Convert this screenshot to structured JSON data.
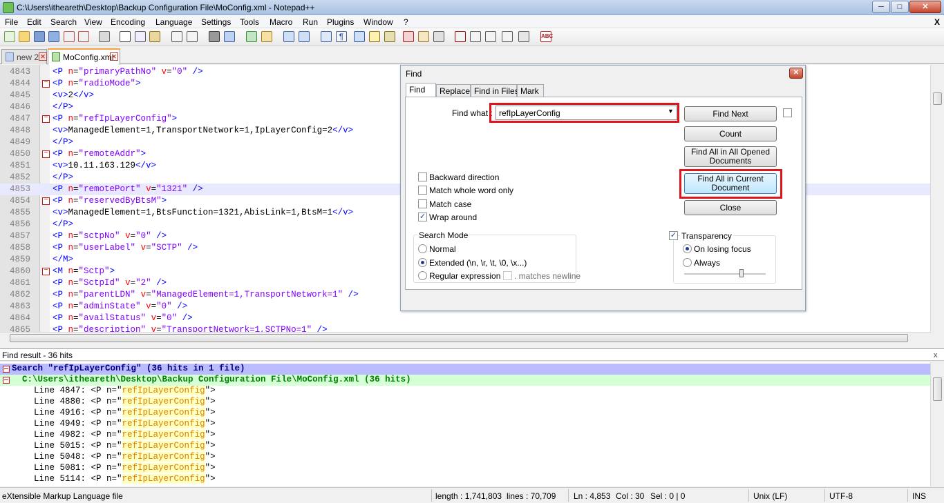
{
  "window": {
    "title": "C:\\Users\\itheareth\\Desktop\\Backup Configuration File\\MoConfig.xml - Notepad++",
    "minimize": "─",
    "maximize": "□",
    "close": "✕"
  },
  "menu": [
    "File",
    "Edit",
    "Search",
    "View",
    "Encoding",
    "Language",
    "Settings",
    "Tools",
    "Macro",
    "Run",
    "Plugins",
    "Window",
    "?"
  ],
  "menu_close": "X",
  "tabs": [
    {
      "label": "new 2",
      "active": false
    },
    {
      "label": "MoConfig.xml",
      "active": true
    }
  ],
  "editor": {
    "lines": [
      {
        "num": "4843",
        "fold": "",
        "code": [
          [
            "tg",
            "<P "
          ],
          [
            "at",
            "n"
          ],
          [
            "tx",
            "="
          ],
          [
            "av",
            "\"primaryPathNo\""
          ],
          [
            "tx",
            " "
          ],
          [
            "at",
            "v"
          ],
          [
            "tx",
            "="
          ],
          [
            "av",
            "\"0\""
          ],
          [
            "tg",
            " />"
          ]
        ]
      },
      {
        "num": "4844",
        "fold": "−",
        "code": [
          [
            "tg",
            "<P "
          ],
          [
            "at",
            "n"
          ],
          [
            "tx",
            "="
          ],
          [
            "av",
            "\"radioMode\""
          ],
          [
            "tg",
            ">"
          ]
        ]
      },
      {
        "num": "4845",
        "fold": "",
        "code": [
          [
            "tg",
            "<v>"
          ],
          [
            "tx",
            "2"
          ],
          [
            "tg",
            "</v>"
          ]
        ]
      },
      {
        "num": "4846",
        "fold": "",
        "code": [
          [
            "tg",
            "</P>"
          ]
        ]
      },
      {
        "num": "4847",
        "fold": "−",
        "code": [
          [
            "tg",
            "<P "
          ],
          [
            "at",
            "n"
          ],
          [
            "tx",
            "="
          ],
          [
            "av",
            "\"refIpLayerConfig\""
          ],
          [
            "tg",
            ">"
          ]
        ]
      },
      {
        "num": "4848",
        "fold": "",
        "code": [
          [
            "tg",
            "<v>"
          ],
          [
            "tx",
            "ManagedElement=1,TransportNetwork=1,IpLayerConfig=2"
          ],
          [
            "tg",
            "</v>"
          ]
        ]
      },
      {
        "num": "4849",
        "fold": "",
        "code": [
          [
            "tg",
            "</P>"
          ]
        ]
      },
      {
        "num": "4850",
        "fold": "−",
        "code": [
          [
            "tg",
            "<P "
          ],
          [
            "at",
            "n"
          ],
          [
            "tx",
            "="
          ],
          [
            "av",
            "\"remoteAddr\""
          ],
          [
            "tg",
            ">"
          ]
        ]
      },
      {
        "num": "4851",
        "fold": "",
        "code": [
          [
            "tg",
            "<v>"
          ],
          [
            "tx",
            "10.11.163.129"
          ],
          [
            "tg",
            "</v>"
          ]
        ]
      },
      {
        "num": "4852",
        "fold": "",
        "code": [
          [
            "tg",
            "</P>"
          ]
        ]
      },
      {
        "num": "4853",
        "fold": "",
        "current": true,
        "code": [
          [
            "tg",
            "<P "
          ],
          [
            "at",
            "n"
          ],
          [
            "tx",
            "="
          ],
          [
            "av",
            "\"remotePort\""
          ],
          [
            "tx",
            " "
          ],
          [
            "at",
            "v"
          ],
          [
            "tx",
            "="
          ],
          [
            "av",
            "\"1321\""
          ],
          [
            "tg",
            " />"
          ]
        ]
      },
      {
        "num": "4854",
        "fold": "−",
        "code": [
          [
            "tg",
            "<P "
          ],
          [
            "at",
            "n"
          ],
          [
            "tx",
            "="
          ],
          [
            "av",
            "\"reservedByBtsM\""
          ],
          [
            "tg",
            ">"
          ]
        ]
      },
      {
        "num": "4855",
        "fold": "",
        "code": [
          [
            "tg",
            "<v>"
          ],
          [
            "tx",
            "ManagedElement=1,BtsFunction=1321,AbisLink=1,BtsM=1"
          ],
          [
            "tg",
            "</v>"
          ]
        ]
      },
      {
        "num": "4856",
        "fold": "",
        "code": [
          [
            "tg",
            "</P>"
          ]
        ]
      },
      {
        "num": "4857",
        "fold": "",
        "code": [
          [
            "tg",
            "<P "
          ],
          [
            "at",
            "n"
          ],
          [
            "tx",
            "="
          ],
          [
            "av",
            "\"sctpNo\""
          ],
          [
            "tx",
            " "
          ],
          [
            "at",
            "v"
          ],
          [
            "tx",
            "="
          ],
          [
            "av",
            "\"0\""
          ],
          [
            "tg",
            " />"
          ]
        ]
      },
      {
        "num": "4858",
        "fold": "",
        "code": [
          [
            "tg",
            "<P "
          ],
          [
            "at",
            "n"
          ],
          [
            "tx",
            "="
          ],
          [
            "av",
            "\"userLabel\""
          ],
          [
            "tx",
            " "
          ],
          [
            "at",
            "v"
          ],
          [
            "tx",
            "="
          ],
          [
            "av",
            "\"SCTP\""
          ],
          [
            "tg",
            " />"
          ]
        ]
      },
      {
        "num": "4859",
        "fold": "",
        "code": [
          [
            "tg",
            "</M>"
          ]
        ]
      },
      {
        "num": "4860",
        "fold": "−",
        "code": [
          [
            "tg",
            "<M "
          ],
          [
            "at",
            "n"
          ],
          [
            "tx",
            "="
          ],
          [
            "av",
            "\"Sctp\""
          ],
          [
            "tg",
            ">"
          ]
        ]
      },
      {
        "num": "4861",
        "fold": "",
        "code": [
          [
            "tg",
            "<P "
          ],
          [
            "at",
            "n"
          ],
          [
            "tx",
            "="
          ],
          [
            "av",
            "\"SctpId\""
          ],
          [
            "tx",
            " "
          ],
          [
            "at",
            "v"
          ],
          [
            "tx",
            "="
          ],
          [
            "av",
            "\"2\""
          ],
          [
            "tg",
            " />"
          ]
        ]
      },
      {
        "num": "4862",
        "fold": "",
        "code": [
          [
            "tg",
            "<P "
          ],
          [
            "at",
            "n"
          ],
          [
            "tx",
            "="
          ],
          [
            "av",
            "\"parentLDN\""
          ],
          [
            "tx",
            " "
          ],
          [
            "at",
            "v"
          ],
          [
            "tx",
            "="
          ],
          [
            "av",
            "\"ManagedElement=1,TransportNetwork=1\""
          ],
          [
            "tg",
            " />"
          ]
        ]
      },
      {
        "num": "4863",
        "fold": "",
        "code": [
          [
            "tg",
            "<P "
          ],
          [
            "at",
            "n"
          ],
          [
            "tx",
            "="
          ],
          [
            "av",
            "\"adminState\""
          ],
          [
            "tx",
            " "
          ],
          [
            "at",
            "v"
          ],
          [
            "tx",
            "="
          ],
          [
            "av",
            "\"0\""
          ],
          [
            "tg",
            " />"
          ]
        ]
      },
      {
        "num": "4864",
        "fold": "",
        "code": [
          [
            "tg",
            "<P "
          ],
          [
            "at",
            "n"
          ],
          [
            "tx",
            "="
          ],
          [
            "av",
            "\"availStatus\""
          ],
          [
            "tx",
            " "
          ],
          [
            "at",
            "v"
          ],
          [
            "tx",
            "="
          ],
          [
            "av",
            "\"0\""
          ],
          [
            "tg",
            " />"
          ]
        ]
      },
      {
        "num": "4865",
        "fold": "",
        "code": [
          [
            "tg",
            "<P "
          ],
          [
            "at",
            "n"
          ],
          [
            "tx",
            "="
          ],
          [
            "av",
            "\"description\""
          ],
          [
            "tx",
            " "
          ],
          [
            "at",
            "v"
          ],
          [
            "tx",
            "="
          ],
          [
            "av",
            "\"TransportNetwork=1,SCTPNo=1\""
          ],
          [
            "tg",
            " />"
          ]
        ]
      }
    ]
  },
  "find_dialog": {
    "title": "Find",
    "close": "✕",
    "tabs": [
      "Find",
      "Replace",
      "Find in Files",
      "Mark"
    ],
    "find_what_label": "Find what :",
    "find_what_value": "refIpLayerConfig",
    "buttons": {
      "find_next": "Find Next",
      "count": "Count",
      "find_all_opened_1": "Find All in All Opened",
      "find_all_opened_2": "Documents",
      "find_all_current_1": "Find All in Current",
      "find_all_current_2": "Document",
      "close": "Close"
    },
    "options": {
      "backward": {
        "label": "Backward direction",
        "checked": false
      },
      "whole_word": {
        "label": "Match whole word only",
        "checked": false
      },
      "match_case": {
        "label": "Match case",
        "checked": false
      },
      "wrap_around": {
        "label": "Wrap around",
        "checked": true
      }
    },
    "search_mode": {
      "title": "Search Mode",
      "normal": "Normal",
      "extended": "Extended (\\n, \\r, \\t, \\0, \\x...)",
      "regex": "Regular expression",
      "matches_newline": ". matches newline",
      "selected": "extended"
    },
    "transparency": {
      "label": "Transparency",
      "checked": true,
      "on_losing_focus": "On losing focus",
      "always": "Always",
      "selected": "on_losing_focus"
    },
    "checkmark": "✓"
  },
  "find_result": {
    "title": "Find result - 36 hits",
    "close": "x",
    "search_line": "Search \"refIpLayerConfig\" (36 hits in 1 file)",
    "file_line": "  C:\\Users\\itheareth\\Desktop\\Backup Configuration File\\MoConfig.xml (36 hits)",
    "hit_prefix": "<P n=\"",
    "hit_match": "refIpLayerConfig",
    "hit_suffix": "\">",
    "hits": [
      "Line 4847:",
      "Line 4880:",
      "Line 4916:",
      "Line 4949:",
      "Line 4982:",
      "Line 5015:",
      "Line 5048:",
      "Line 5081:",
      "Line 5114:"
    ]
  },
  "status": {
    "file_type": "eXtensible Markup Language file",
    "length": "length : 1,741,803",
    "lines": "lines : 70,709",
    "ln": "Ln : 4,853",
    "col": "Col : 30",
    "sel": "Sel : 0 | 0",
    "eol": "Unix (LF)",
    "encoding": "UTF-8",
    "mode": "INS"
  }
}
